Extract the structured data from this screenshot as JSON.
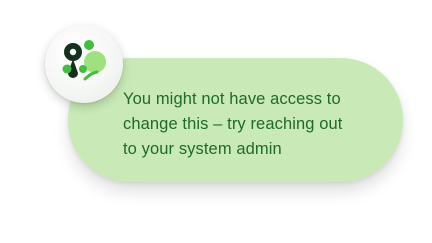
{
  "message": {
    "lines": [
      "You might not have access to",
      "change this – try reaching out",
      "to your system admin"
    ]
  },
  "avatar": {
    "icon": "brand-blob-logo-icon",
    "colors": {
      "dark": "#15301c",
      "green": "#3fbf3a",
      "light": "#9fe07f"
    }
  },
  "bubble": {
    "background": "#c9eab7",
    "text_color": "#1e6b26"
  }
}
